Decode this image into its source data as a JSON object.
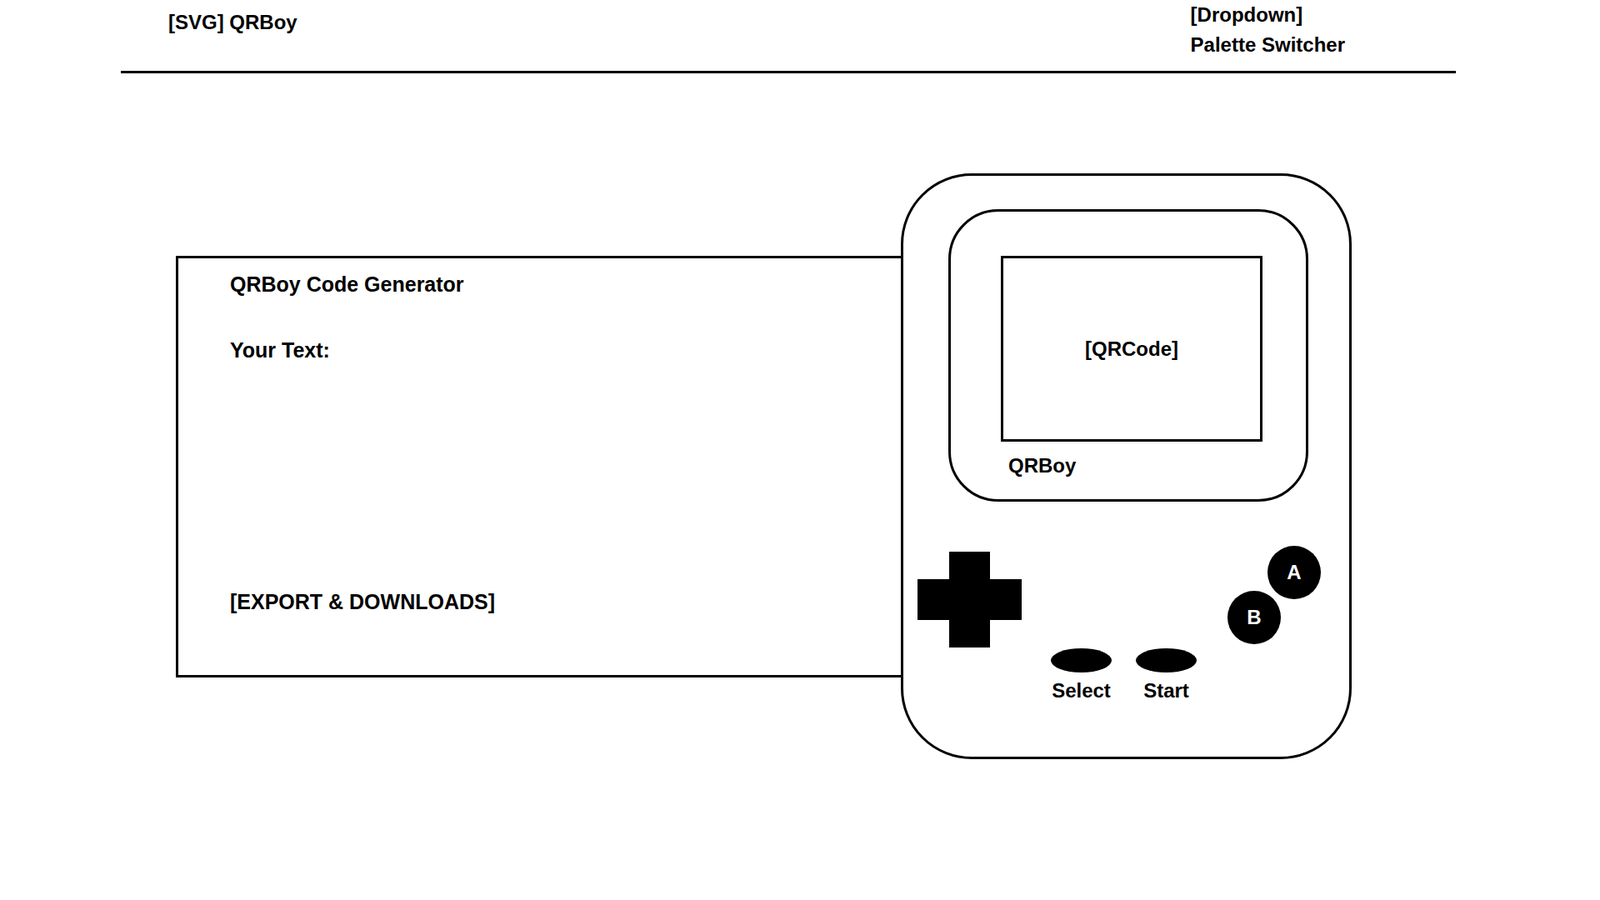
{
  "header": {
    "logo": "[SVG] QRBoy",
    "dropdown": {
      "tag": "[Dropdown]",
      "label": "Palette Switcher"
    }
  },
  "generator": {
    "title": "QRBoy Code Generator",
    "input_label": "Your Text:",
    "export": "[EXPORT & DOWNLOADS]"
  },
  "device": {
    "screen": "[QRCode]",
    "brand": "QRBoy",
    "action_buttons": [
      {
        "label": "A"
      },
      {
        "label": "B"
      }
    ],
    "menu_buttons": [
      {
        "label": "Select"
      },
      {
        "label": "Start"
      }
    ]
  }
}
